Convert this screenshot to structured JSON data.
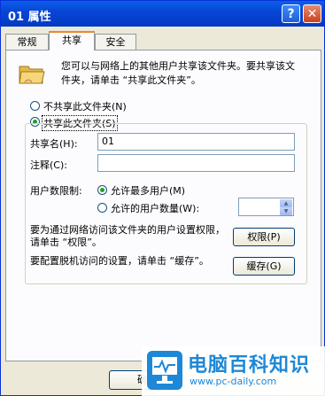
{
  "window": {
    "title": "01 属性",
    "help_symbol": "?",
    "close_symbol": "✕"
  },
  "tabs": [
    {
      "label": "常规"
    },
    {
      "label": "共享"
    },
    {
      "label": "安全"
    }
  ],
  "intro_text": "您可以与网络上的其他用户共享该文件夹。要共享该文件夹，请单击 “共享此文件夹”。",
  "share_options": {
    "not_share": "不共享此文件夹(N)",
    "share": "共享此文件夹(S)"
  },
  "share_name": {
    "label": "共享名(H):",
    "value": "01"
  },
  "comment": {
    "label": "注释(C):",
    "value": ""
  },
  "user_limit": {
    "label": "用户数限制:",
    "max_allowed": "允许最多用户(M)",
    "allow_count": "允许的用户数量(W):",
    "count_value": ""
  },
  "permissions": {
    "text": "要为通过网络访问该文件夹的用户设置权限，请单击 “权限”。",
    "button": "权限(P)"
  },
  "caching": {
    "text": "要配置脱机访问的设置，请单击 “缓存”。",
    "button": "缓存(G)"
  },
  "footer": {
    "ok_button": "确"
  },
  "watermark": {
    "main": "电脑百科知识",
    "url": "www.pc-daily.com"
  },
  "colors": {
    "titlebar": "#0846d6",
    "face": "#ece9d8",
    "panel": "#fcfcfe",
    "accent": "#1e88d8"
  }
}
